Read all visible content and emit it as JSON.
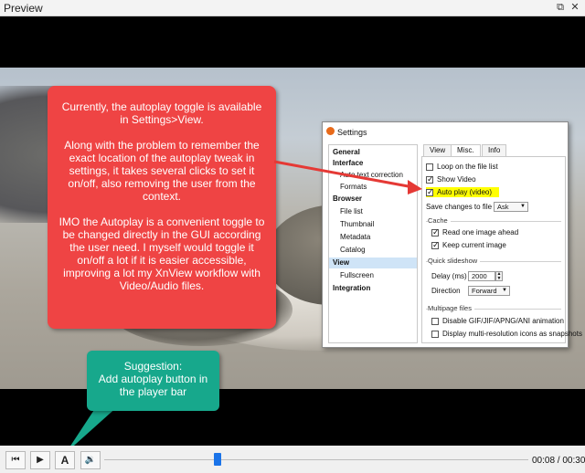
{
  "window": {
    "title": "Preview",
    "restore_icon": "restore-icon",
    "close_icon": "close-icon"
  },
  "annotation": {
    "red_paragraphs": [
      "Currently, the autoplay toggle is available in Settings>View.",
      "Along with the problem to remember the exact location of the autoplay tweak in settings, it takes several clicks to set it on/off, also removing the user from the context.",
      "IMO the Autoplay is a convenient toggle to be changed directly in the GUI according the user need. I myself would toggle it on/off a lot if it is easier accessible, improving a lot my XnView workflow with Video/Audio files."
    ],
    "suggestion_lines": [
      "Suggestion:",
      "Add autoplay button in",
      "the player bar"
    ],
    "colors": {
      "red": "#ef4444",
      "green": "#17a88c"
    }
  },
  "settings_dialog": {
    "title": "Settings",
    "categories": [
      {
        "label": "General",
        "bold": true
      },
      {
        "label": "Interface",
        "bold": true
      },
      {
        "label": "Auto text correction",
        "bold": false
      },
      {
        "label": "Formats",
        "bold": false
      },
      {
        "label": "Browser",
        "bold": true
      },
      {
        "label": "File list",
        "bold": false
      },
      {
        "label": "Thumbnail",
        "bold": false
      },
      {
        "label": "Metadata",
        "bold": false
      },
      {
        "label": "Catalog",
        "bold": false
      },
      {
        "label": "View",
        "bold": true,
        "selected": true
      },
      {
        "label": "Fullscreen",
        "bold": false
      },
      {
        "label": "Integration",
        "bold": true
      }
    ],
    "tabs": [
      "View",
      "Misc.",
      "Info"
    ],
    "active_tab": "Misc.",
    "options": {
      "loop": {
        "label": "Loop on the file list",
        "checked": false
      },
      "show_video": {
        "label": "Show Video",
        "checked": true
      },
      "auto_play": {
        "label": "Auto play (video)",
        "checked": true
      },
      "save_changes_label": "Save changes to file",
      "save_changes_value": "Ask",
      "cache_label": "Cache",
      "read_ahead": {
        "label": "Read one image ahead",
        "checked": true
      },
      "keep_current": {
        "label": "Keep current image",
        "checked": true
      },
      "quick_slideshow_label": "Quick slideshow",
      "delay_label": "Delay (ms)",
      "delay_value": "2000",
      "direction_label": "Direction",
      "direction_value": "Forward",
      "multipage_label": "Multipage files",
      "disable_gif": {
        "label": "Disable GIF/JIF/APNG/ANI animation",
        "checked": false
      },
      "display_multi": {
        "label": "Display multi-resolution icons as snapshots",
        "checked": false
      }
    }
  },
  "player": {
    "autoplay_label": "A",
    "time_text": "00:08 / 00:30",
    "progress": 0.267
  }
}
